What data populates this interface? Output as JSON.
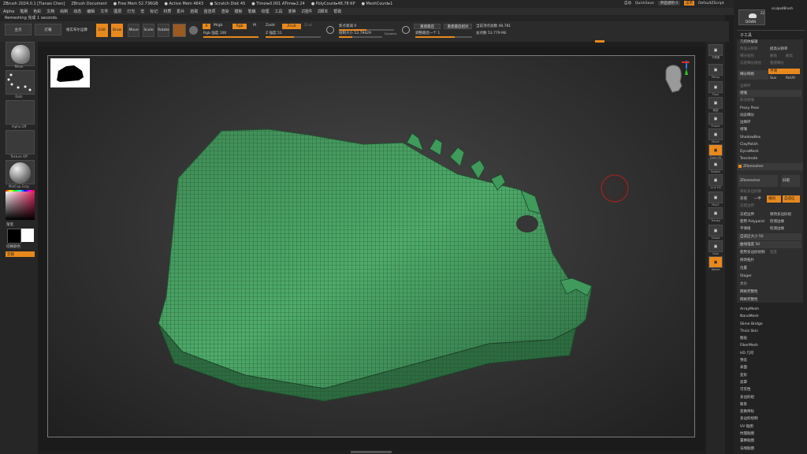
{
  "titlebar": {
    "app": "ZBrush 2024.0.1 [Tianao Chen]",
    "doc": "ZBrush Document",
    "free_mem": "● Free Mem 52.736GB",
    "active_mem": "● Active Mem 4643",
    "scratch": "● Scratch Disk 45",
    "timer": "● Timer▸0.001 ATime▸2.24",
    "polycount": "● PolyCount▸48.78 KP",
    "meshcount": "● MeshCount▸1",
    "autosave": "自动",
    "quicksave": "QuickSave",
    "transp": "界面透明 0",
    "menus": "菜单",
    "defaultscript": "DefaultZScript"
  },
  "menubar": [
    "Alpha",
    "笔刷",
    "色彩",
    "文档",
    "绘制",
    "动态",
    "编辑",
    "文件",
    "图层",
    "灯光",
    "宏",
    "标记",
    "材质",
    "影片",
    "拾取",
    "首选项",
    "渲染",
    "模板",
    "笔触",
    "纹理",
    "工具",
    "变换",
    "Z插件",
    "Z脚本",
    "帮助"
  ],
  "status": "Remeshing 完成 1 seconds.",
  "toolbar": {
    "projection": "主页",
    "lightbox": "灯箱",
    "live_boolean": "根实布尔运算",
    "edit": "Edit",
    "draw": "Draw",
    "move": "Move",
    "scale": "Scale",
    "rotate": "Rotate",
    "a": "A",
    "mrgb": "Mrgb",
    "rgb": "Rgb",
    "m": "M",
    "rgb_intensity": "Rgb 强度 100",
    "zadd": "Zadd",
    "zsub": "Zsub",
    "zcut": "Zcut",
    "z_intensity": "Z 强度 51",
    "focal_shift": "焦点衰减 0",
    "draw_size": "绘制大小 53.79429",
    "dynamic": "Dynamic",
    "sculpt_fine": "重建最后",
    "sculpt_fine_rel": "重建最后相对",
    "adjust_last": "调整最后一个 1",
    "active_points": "当前顶点总数 48,781",
    "total_points": "总点数 53.779 Mil"
  },
  "leftshelf": {
    "brush": "Move",
    "stroke": "Dots",
    "alpha": "Alpha Off",
    "texture": "Texture Off",
    "material": "MatCap Gray",
    "gradient": "渐变",
    "switch_color": "切换颜色",
    "alternate": "交替"
  },
  "rightshelf": {
    "labels": [
      "子像素",
      "Persp",
      "Floor",
      "局部",
      "Frame",
      "Move",
      "Zoom3D",
      "Rotate",
      "Line Fill",
      "PolyF",
      "Transp",
      "Ghost",
      "Solo",
      "Xpose"
    ],
    "dynamic": "Dynamic"
  },
  "subtool": {
    "name": "sculpedBrush",
    "count": "22",
    "down": "DOWN"
  },
  "panel": {
    "header": "子工具",
    "section_geometry": "几何体编辑",
    "lower_res": "降低分辨率",
    "higher_res": "提高分辨率",
    "subdiv_level": "细分级别",
    "delete_lower": "删低",
    "delete_higher": "删高",
    "freeze_subdiv": "冻结细分级别",
    "reconstruct": "重建细分",
    "divide": "细分网格",
    "smt": "平滑",
    "suv": "Suv",
    "rsmt": "ReUV",
    "edgeloop_title": "边缘环",
    "crease": "褶皱",
    "uncrease": "取消褶皱",
    "proxy": "Proxy Pose",
    "dynamic_subdiv": "动态细分",
    "edge_loop": "边缘环",
    "shadowbox": "ShadowBox",
    "claypolish": "ClayPolish",
    "dynamesh": "DynaMesh",
    "tessimate": "Tessimate",
    "remesher": "ZRemesher",
    "zremesher_btn": "ZRemesher",
    "legacy": "旧版",
    "target_count": "目标多边形数",
    "half": "一半",
    "same": "相同",
    "adaptive": "自适应",
    "double": "双倍",
    "freeze_borders": "冻结边界",
    "keep_groups": "保持多边形组",
    "keep_polypaint": "使用 Polypaint",
    "detect_edges": "检测边缘",
    "smooth_groups": "平滑组",
    "adaptive_size": "自适应大小 50",
    "curve_strength": "曲线强度 50",
    "use_polypaint": "使用多边形绘制",
    "density": "密度",
    "modify_topology": "修改拓扑",
    "position": "位置",
    "size": "大小",
    "stager": "Stager",
    "mesh_integrity": "网格完整性"
  },
  "tool_list": [
    "ArrayMesh",
    "NanoMesh",
    "Slime Bridge",
    "Thick Skin",
    "图层",
    "FiberMesh",
    "HD 几何",
    "预览",
    "表面",
    "变形",
    "遮罩",
    "可见性",
    "多边形组",
    "联系",
    "变换目标",
    "多边形绘制",
    "UV 贴图",
    "纹理贴图",
    "置换贴图",
    "法线贴图"
  ],
  "colors": {
    "accent": "#e8891e",
    "mesh": "#3f9a5c",
    "wire": "#1f4a2b"
  }
}
